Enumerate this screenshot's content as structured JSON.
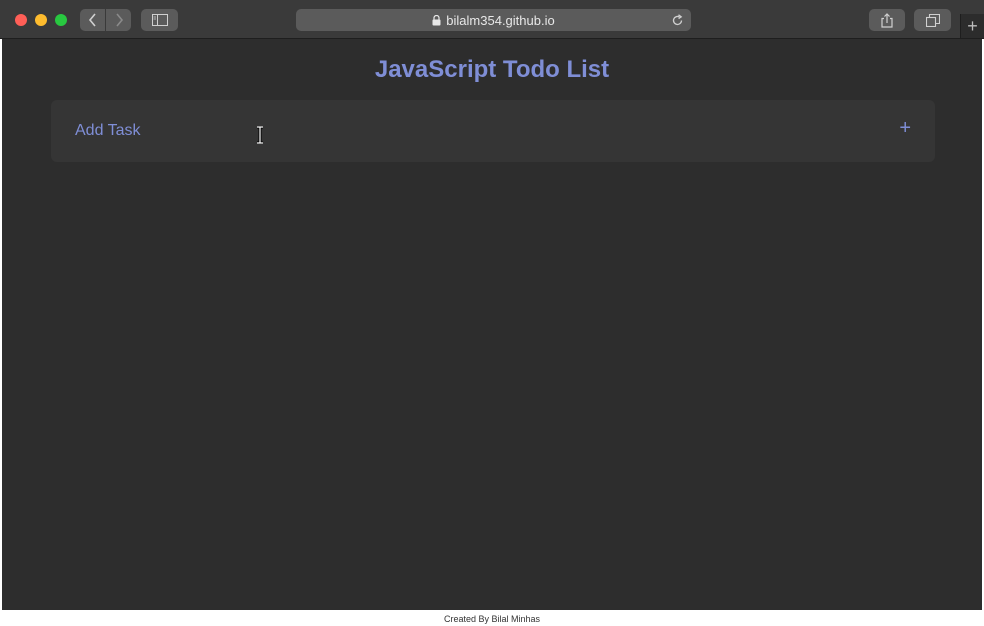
{
  "browser": {
    "address_text": "bilalm354.github.io",
    "icons": [
      "back-icon",
      "forward-icon",
      "sidebar-icon",
      "lock-icon",
      "reload-icon",
      "share-icon",
      "tabs-icon",
      "plus-icon"
    ]
  },
  "app": {
    "title": "JavaScript Todo List",
    "add_task_label": "Add Task",
    "add_plus": "+"
  },
  "footer": {
    "text": "Created By Bilal Minhas"
  },
  "colors": {
    "accent": "#7f8ed6",
    "page_bg": "#2d2d2d",
    "card_bg": "#353535",
    "toolbar_bg": "#3a3a3a"
  }
}
